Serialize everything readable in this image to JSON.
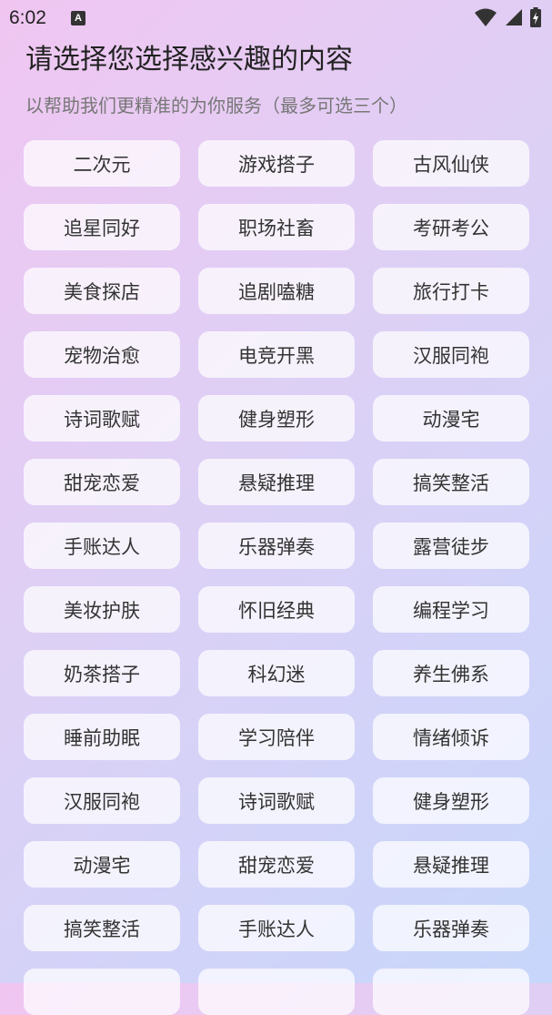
{
  "status_bar": {
    "time": "6:02",
    "notification_icon": "A"
  },
  "header": {
    "title": "请选择您选择感兴趣的内容",
    "subtitle": "以帮助我们更精准的为你服务（最多可选三个）"
  },
  "tags": [
    "二次元",
    "游戏搭子",
    "古风仙侠",
    "追星同好",
    "职场社畜",
    "考研考公",
    "美食探店",
    "追剧嗑糖",
    "旅行打卡",
    "宠物治愈",
    "电竞开黑",
    "汉服同袍",
    "诗词歌赋",
    "健身塑形",
    "动漫宅",
    "甜宠恋爱",
    "悬疑推理",
    "搞笑整活",
    "手账达人",
    "乐器弹奏",
    "露营徒步",
    "美妆护肤",
    "怀旧经典",
    "编程学习",
    "奶茶搭子",
    "科幻迷",
    "养生佛系",
    "睡前助眠",
    "学习陪伴",
    "情绪倾诉",
    "汉服同袍",
    "诗词歌赋",
    "健身塑形",
    "动漫宅",
    "甜宠恋爱",
    "悬疑推理",
    "搞笑整活",
    "手账达人",
    "乐器弹奏",
    "",
    "",
    ""
  ]
}
